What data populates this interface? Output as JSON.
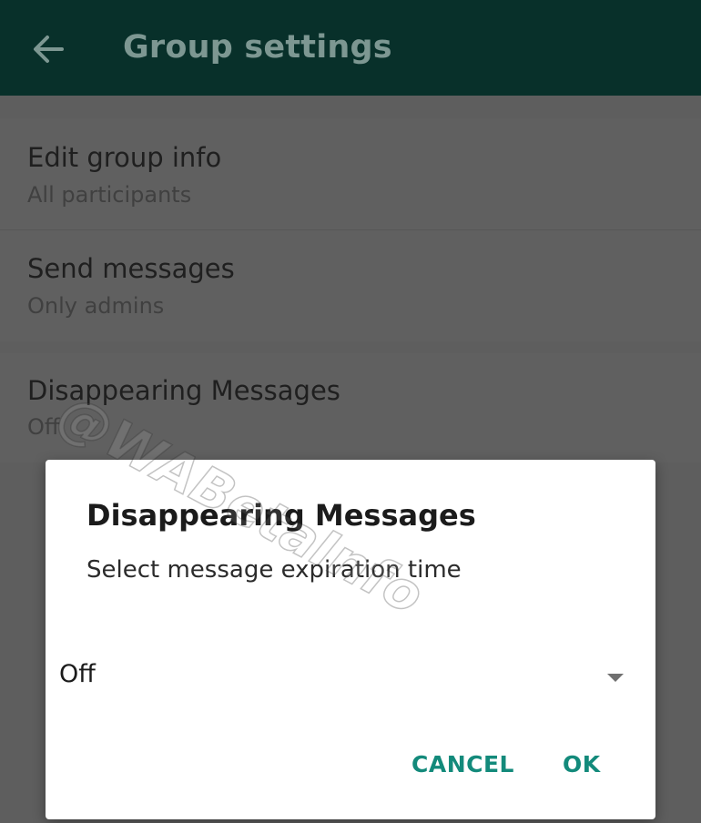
{
  "appbar": {
    "back_icon": "arrow-left-icon",
    "title": "Group settings"
  },
  "settings": {
    "items": [
      {
        "title": "Edit group info",
        "subtitle": "All participants"
      },
      {
        "title": "Send messages",
        "subtitle": "Only admins"
      },
      {
        "title": "Disappearing Messages",
        "subtitle": "Off"
      }
    ]
  },
  "watermark": "@WABetaInfo",
  "dialog": {
    "title": "Disappearing Messages",
    "message": "Select message expiration time",
    "dropdown": {
      "selected": "Off",
      "icon": "dropdown-arrow-icon"
    },
    "cancel_label": "CANCEL",
    "ok_label": "OK"
  },
  "colors": {
    "appbar_bg": "#08302a",
    "accent": "#138a7b",
    "scrim_bg": "#5e5e5e"
  }
}
